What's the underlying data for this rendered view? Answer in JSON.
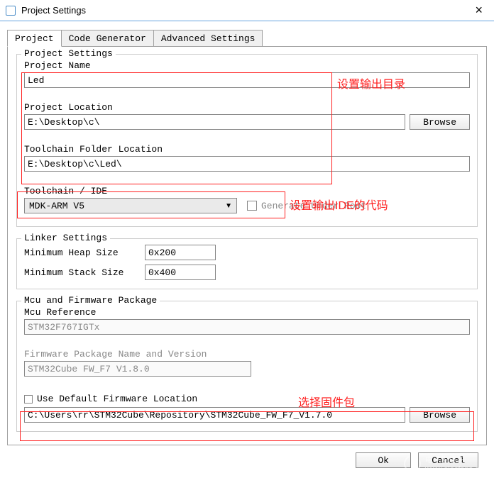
{
  "window": {
    "title": "Project Settings",
    "close": "×"
  },
  "tabs": {
    "project": "Project",
    "code_generator": "Code Generator",
    "advanced": "Advanced Settings"
  },
  "project_settings": {
    "legend": "Project Settings",
    "name_label": "Project Name",
    "name_value": "Led",
    "location_label": "Project Location",
    "location_value": "E:\\Desktop\\c\\",
    "browse": "Browse",
    "toolchain_folder_label": "Toolchain Folder Location",
    "toolchain_folder_value": "E:\\Desktop\\c\\Led\\",
    "ide_label": "Toolchain / IDE",
    "ide_value": "MDK-ARM V5",
    "generate_under_root": "Generate Under Root"
  },
  "linker": {
    "legend": "Linker Settings",
    "heap_label": "Minimum Heap Size",
    "heap_value": "0x200",
    "stack_label": "Minimum Stack Size",
    "stack_value": "0x400"
  },
  "mcu": {
    "legend": "Mcu and Firmware Package",
    "ref_label": "Mcu Reference",
    "ref_value": "STM32F767IGTx",
    "fw_label": "Firmware Package Name and Version",
    "fw_value": "STM32Cube FW_F7 V1.8.0",
    "use_default": "Use Default Firmware Location",
    "fw_path": "C:\\Users\\rr\\STM32Cube\\Repository\\STM32Cube_FW_F7_V1.7.0",
    "browse": "Browse"
  },
  "footer": {
    "ok": "Ok",
    "cancel": "Cancel"
  },
  "annotations": {
    "output_dir": "设置输出目录",
    "output_ide": "设置输出IDE的代码",
    "select_fw": "选择固件包"
  },
  "watermark": {
    "text1": "电子发烧友",
    "text2": "www.elecfans.com"
  }
}
